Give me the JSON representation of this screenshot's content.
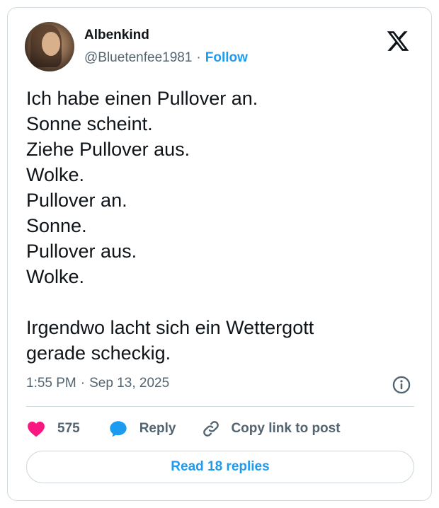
{
  "author": {
    "name": "Albenkind",
    "handle": "@Bluetenfee1981",
    "separator": "·",
    "follow_label": "Follow"
  },
  "brand_icon": "x-logo-icon",
  "tweet": {
    "text": "Ich habe einen Pullover an.\nSonne scheint.\nZiehe Pullover aus.\nWolke.\nPullover an.\nSonne.\nPullover aus.\nWolke.\n\nIrgendwo lacht sich ein Wettergott\ngerade scheckig.",
    "time": "1:55 PM",
    "separator": "·",
    "date": "Sep 13, 2025"
  },
  "actions": {
    "like_count": "575",
    "reply_label": "Reply",
    "copy_link_label": "Copy link to post"
  },
  "read_replies_label": "Read 18 replies",
  "colors": {
    "accent": "#1d9bf0",
    "like": "#f91880",
    "text": "#0f1419",
    "muted": "#536471",
    "border": "#cfd9de"
  }
}
